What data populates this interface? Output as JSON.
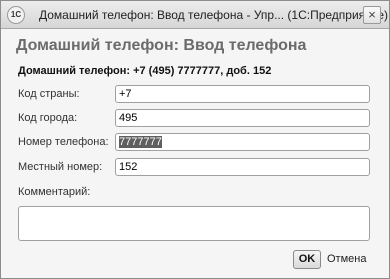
{
  "window": {
    "title": "Домашний телефон: Ввод телефона - Упр...  (1С:Предприятие)",
    "app_icon_text": "1С",
    "close_label": "×"
  },
  "form": {
    "heading": "Домашний телефон: Ввод телефона",
    "summary": "Домашний телефон: +7 (495) 7777777, доб. 152"
  },
  "fields": {
    "country_code": {
      "label": "Код страны:",
      "value": "+7"
    },
    "city_code": {
      "label": "Код города:",
      "value": "495"
    },
    "phone_number": {
      "label": "Номер телефона:",
      "value": "7777777",
      "selected": true
    },
    "extension": {
      "label": "Местный номер:",
      "value": "152"
    },
    "comment": {
      "label": "Комментарий:",
      "value": ""
    }
  },
  "buttons": {
    "ok": "OK",
    "cancel": "Отмена"
  },
  "colors": {
    "heading": "#6b6b6b",
    "selection_bg": "#5f5f5f",
    "window_bg": "#f5f5f5"
  }
}
